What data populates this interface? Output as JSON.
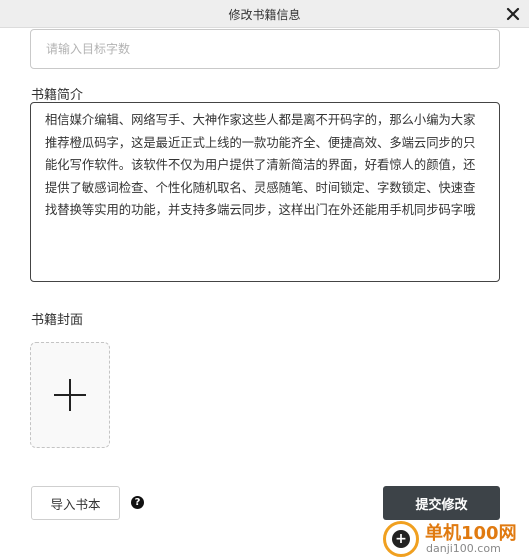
{
  "dialog": {
    "title": "修改书籍信息",
    "close_icon": "close-icon"
  },
  "target_words": {
    "placeholder": "请输入目标字数",
    "value": ""
  },
  "intro": {
    "label": "书籍简介",
    "text": "相信媒介编辑、网络写手、大神作家这些人都是离不开码字的，那么小编为大家推荐橙瓜码字，这是最近正式上线的一款功能齐全、便捷高效、多端云同步的只能化写作软件。该软件不仅为用户提供了清新简洁的界面，好看惊人的颜值，还提供了敏感词检查、个性化随机取名、灵感随笔、时间锁定、字数锁定、快速查找替换等实用的功能，并支持多端云同步，这样出门在外还能用手机同步码字哦"
  },
  "cover": {
    "label": "书籍封面",
    "add_icon": "plus-icon"
  },
  "footer": {
    "import_label": "导入书本",
    "help_symbol": "?",
    "submit_label": "提交修改"
  },
  "watermark": {
    "title": "单机100网",
    "url": "danji100.com"
  },
  "colors": {
    "titlebar_bg": "#eeeeee",
    "submit_bg": "#3d4348",
    "watermark_accent": "#e07a10"
  }
}
